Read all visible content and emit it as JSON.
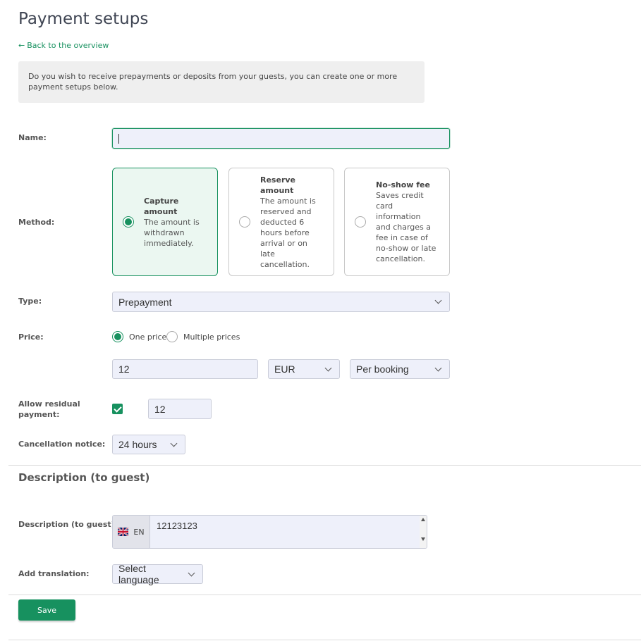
{
  "page": {
    "title": "Payment setups",
    "back_link": "Back to the overview",
    "info_text": "Do you wish to receive prepayments or deposits from your guests, you can create one or more payment setups below."
  },
  "form": {
    "name_label": "Name:",
    "name_value": "",
    "method_label": "Method:",
    "methods": [
      {
        "title": "Capture amount",
        "desc": "The amount is withdrawn immediately.",
        "selected": true
      },
      {
        "title": "Reserve amount",
        "desc": "The amount is reserved and deducted 6 hours before arrival or on late cancellation.",
        "selected": false
      },
      {
        "title": "No-show fee",
        "desc": "Saves credit card information and charges a fee in case of no-show or late cancellation.",
        "selected": false
      }
    ],
    "type_label": "Type:",
    "type_value": "Prepayment",
    "price_label": "Price:",
    "price_options": {
      "one": "One price",
      "multiple": "Multiple prices",
      "selected": "one"
    },
    "price_value": "12",
    "currency_value": "EUR",
    "per_value": "Per booking",
    "residual_label": "Allow residual payment:",
    "residual_checked": true,
    "residual_value": "12",
    "cancellation_label": "Cancellation notice:",
    "cancellation_value": "24 hours"
  },
  "description": {
    "section_title": "Description (to guest)",
    "label": "Description (to guest):",
    "lang_code": "EN",
    "value": "12123123",
    "add_translation_label": "Add translation:",
    "select_language": "Select language"
  },
  "actions": {
    "save_label": "Save"
  },
  "colors": {
    "accent": "#17915f",
    "input_bg": "#eef0fa",
    "info_bg": "#efefef"
  }
}
